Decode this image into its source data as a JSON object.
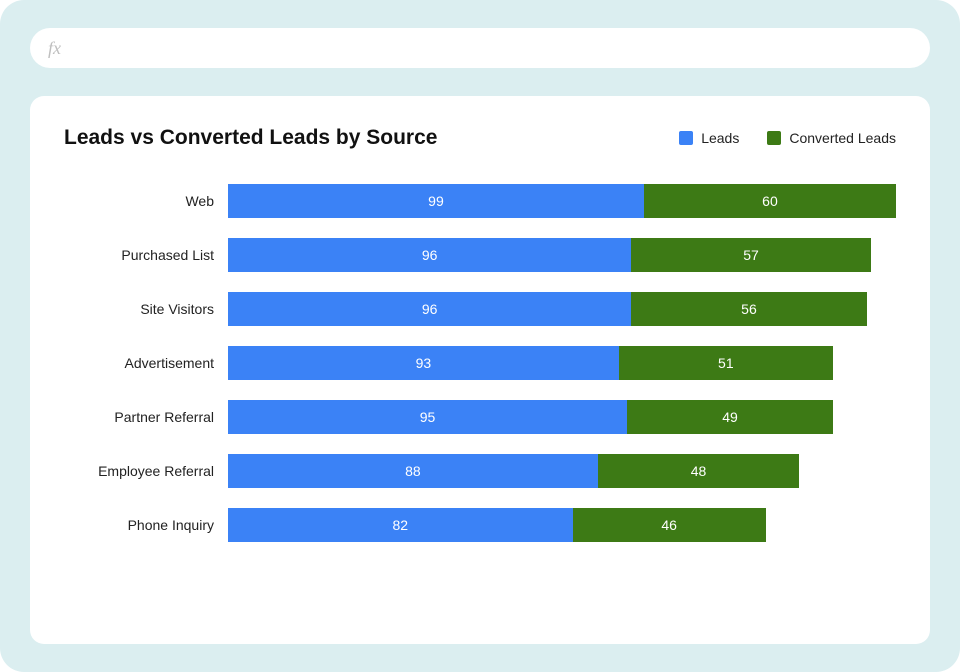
{
  "formula_bar": {
    "fx_label": "fx"
  },
  "chart_data": {
    "type": "bar",
    "orientation": "horizontal",
    "stacked": true,
    "title": "Leads vs Converted Leads by Source",
    "categories": [
      "Web",
      "Purchased List",
      "Site Visitors",
      "Advertisement",
      "Partner Referral",
      "Employee Referral",
      "Phone Inquiry"
    ],
    "series": [
      {
        "name": "Leads",
        "color": "#3b82f6",
        "values": [
          99,
          96,
          96,
          93,
          95,
          88,
          82
        ]
      },
      {
        "name": "Converted Leads",
        "color": "#3d7a15",
        "values": [
          60,
          57,
          56,
          51,
          49,
          48,
          46
        ]
      }
    ],
    "xlabel": "",
    "ylabel": "",
    "legend_position": "top-right",
    "grid": false,
    "value_labels": true
  }
}
